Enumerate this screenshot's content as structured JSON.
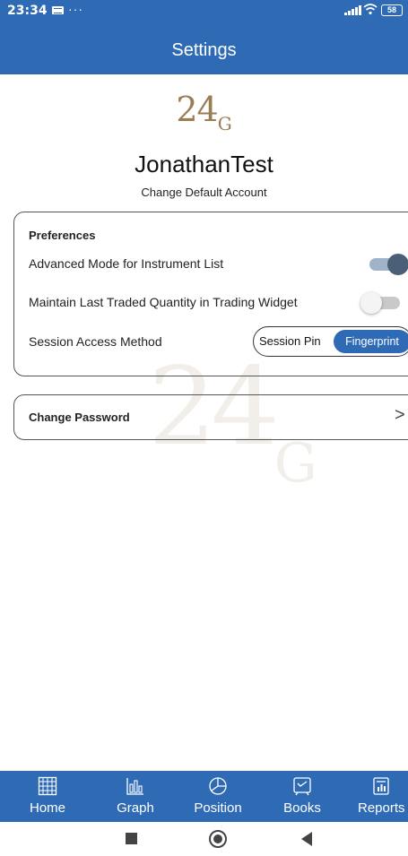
{
  "status_bar": {
    "time": "23:34",
    "dots": "···",
    "battery": "58"
  },
  "header": {
    "title": "Settings"
  },
  "logo": {
    "main": "24",
    "sub": "G"
  },
  "account": {
    "name": "JonathanTest",
    "change_label": "Change Default Account"
  },
  "preferences": {
    "title": "Preferences",
    "advanced_mode_label": "Advanced Mode for Instrument List",
    "advanced_mode_on": true,
    "maintain_qty_label": "Maintain Last Traded Quantity in Trading Widget",
    "maintain_qty_on": false,
    "session_access_label": "Session Access Method",
    "session_options": [
      "Session Pin",
      "Fingerprint"
    ],
    "session_selected": "Fingerprint"
  },
  "password": {
    "label": "Change Password",
    "chevron": ">"
  },
  "bottom_nav": {
    "items": [
      {
        "label": "Home",
        "icon": "grid-icon"
      },
      {
        "label": "Graph",
        "icon": "bar-chart-icon"
      },
      {
        "label": "Position",
        "icon": "pie-chart-icon"
      },
      {
        "label": "Books",
        "icon": "book-icon"
      },
      {
        "label": "Reports",
        "icon": "report-icon"
      }
    ]
  },
  "colors": {
    "primary": "#2f6bb5",
    "logo_gold": "#9a7d55",
    "toggle_on_knob": "#4a6078"
  }
}
